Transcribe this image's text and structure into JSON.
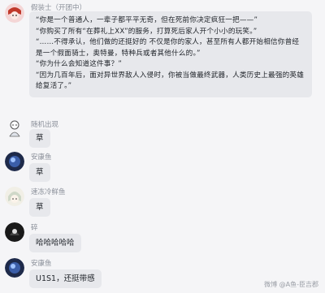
{
  "messages": [
    {
      "name": "假装士（开团中）",
      "paragraphs": [
        "“你是一个普通人，一辈子都平平无奇，但在死前你决定疯狂一把——”",
        "“你购买了所有“在葬礼上XX”的服务，打算死后家人开个小小的玩笑。”",
        "“……不得承认，他们做的还挺好的 不仅是你的家人，甚至所有人都开始相信你曾经是一个假面骑士，奥特曼，特种兵或者其他什么的。”",
        "“你为什么会知道这件事？”",
        "“因为几百年后，面对异世界敌人入侵时，你被当做最终武器，人类历史上最强的英雄给复活了。”"
      ]
    },
    {
      "name": "随机出现",
      "text": "草"
    },
    {
      "name": "安康鱼",
      "text": "草"
    },
    {
      "name": "速冻冷鲜鱼",
      "text": "草"
    },
    {
      "name": "碎",
      "text": "哈哈哈哈哈"
    },
    {
      "name": "安康鱼",
      "text": "U1S1，还挺带感"
    }
  ],
  "watermark": "微博 @A鱼-臣吉郡"
}
